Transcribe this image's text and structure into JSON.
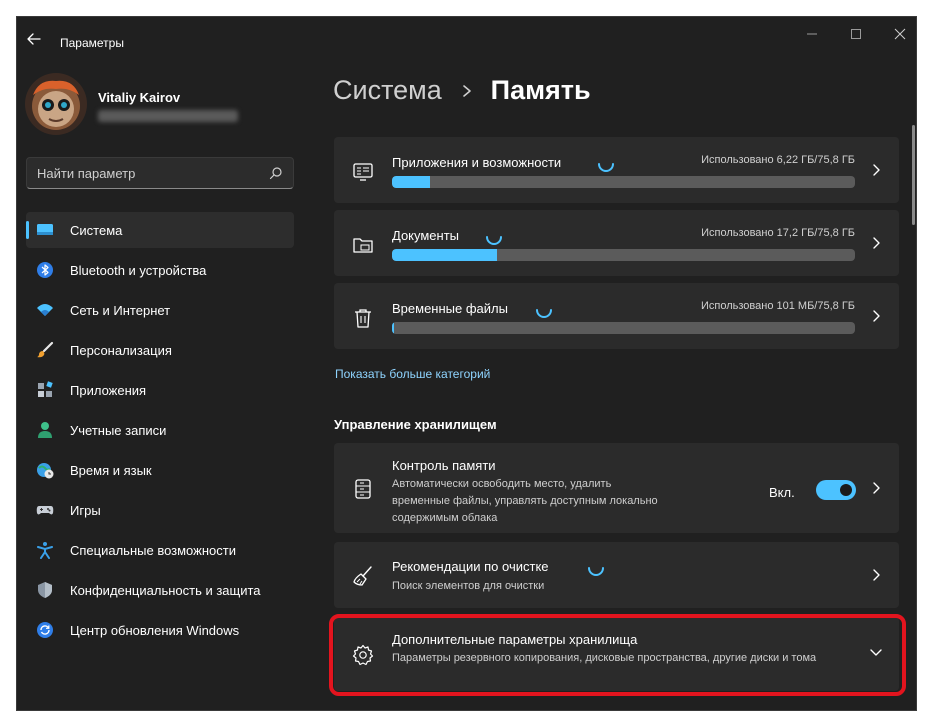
{
  "window": {
    "title": "Параметры"
  },
  "profile": {
    "name": "Vitaliy Kairov"
  },
  "search": {
    "placeholder": "Найти параметр"
  },
  "nav": {
    "items": [
      {
        "label": "Система",
        "icon": "system-icon",
        "active": true
      },
      {
        "label": "Bluetooth и устройства",
        "icon": "bluetooth-icon"
      },
      {
        "label": "Сеть и Интернет",
        "icon": "wifi-icon"
      },
      {
        "label": "Персонализация",
        "icon": "brush-icon"
      },
      {
        "label": "Приложения",
        "icon": "apps-icon"
      },
      {
        "label": "Учетные записи",
        "icon": "person-icon"
      },
      {
        "label": "Время и язык",
        "icon": "globe-clock-icon"
      },
      {
        "label": "Игры",
        "icon": "gamepad-icon"
      },
      {
        "label": "Специальные возможности",
        "icon": "accessibility-icon"
      },
      {
        "label": "Конфиденциальность и защита",
        "icon": "shield-icon"
      },
      {
        "label": "Центр обновления Windows",
        "icon": "update-icon"
      }
    ]
  },
  "breadcrumb": {
    "parent": "Система",
    "current": "Память"
  },
  "usage": [
    {
      "title": "Приложения и возможности",
      "usage_text": "Использовано 6,22 ГБ/75,8 ГБ",
      "fraction": 0.082,
      "icon": "apps-features-icon"
    },
    {
      "title": "Документы",
      "usage_text": "Использовано 17,2 ГБ/75,8 ГБ",
      "fraction": 0.227,
      "icon": "documents-icon"
    },
    {
      "title": "Временные файлы",
      "usage_text": "Использовано 101 МБ/75,8 ГБ",
      "fraction": 0.0013,
      "icon": "trash-icon"
    }
  ],
  "show_more": "Показать больше категорий",
  "management": {
    "section_title": "Управление хранилищем",
    "storage_sense": {
      "title": "Контроль памяти",
      "description": "Автоматически освободить место, удалить временные файлы, управлять доступным локально содержимым облака",
      "toggle_label": "Вкл.",
      "toggle_on": true
    },
    "cleanup": {
      "title": "Рекомендации по очистке",
      "description": "Поиск элементов для очистки"
    },
    "advanced": {
      "title": "Дополнительные параметры хранилища",
      "description": "Параметры резервного копирования, дисковые пространства, другие диски и тома"
    }
  },
  "colors": {
    "accent": "#4cc2ff",
    "highlight": "#e3141e",
    "window_bg": "#202020",
    "card_bg": "#2b2b2b"
  }
}
